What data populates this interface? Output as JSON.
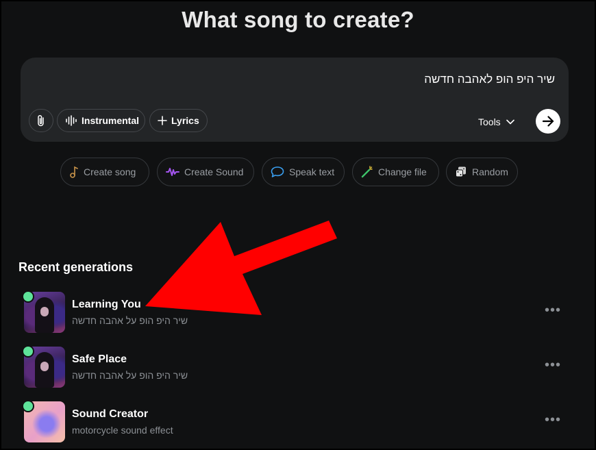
{
  "header": {
    "title": "What song to create?"
  },
  "prompt": {
    "text": "שיר היפ הופ לאהבה חדשה",
    "attach_icon": "paperclip-icon",
    "instrumental_label": "Instrumental",
    "lyrics_label": "Lyrics",
    "tools_label": "Tools",
    "submit_icon": "arrow-right-icon"
  },
  "chips": [
    {
      "label": "Create song",
      "icon": "music-note-icon",
      "color": "#c9944a"
    },
    {
      "label": "Create Sound",
      "icon": "waveform-icon",
      "color": "#a455f0"
    },
    {
      "label": "Speak text",
      "icon": "speech-bubble-icon",
      "color": "#3a9ff0"
    },
    {
      "label": "Change file",
      "icon": "magic-wand-icon",
      "color": "#3ec46a"
    },
    {
      "label": "Random",
      "icon": "dice-icon",
      "color": "#d0d0d0"
    }
  ],
  "recent": {
    "title": "Recent generations",
    "items": [
      {
        "title": "Learning You",
        "subtitle": "שיר היפ הופ על אהבה חדשה"
      },
      {
        "title": "Safe Place",
        "subtitle": "שיר היפ הופ על אהבה חדשה"
      },
      {
        "title": "Sound Creator",
        "subtitle": "motorcycle sound effect"
      }
    ]
  },
  "colors": {
    "background": "#101112",
    "prompt_box": "#232527",
    "status_dot": "#5ee39a",
    "annotation_arrow": "#ff0000"
  }
}
